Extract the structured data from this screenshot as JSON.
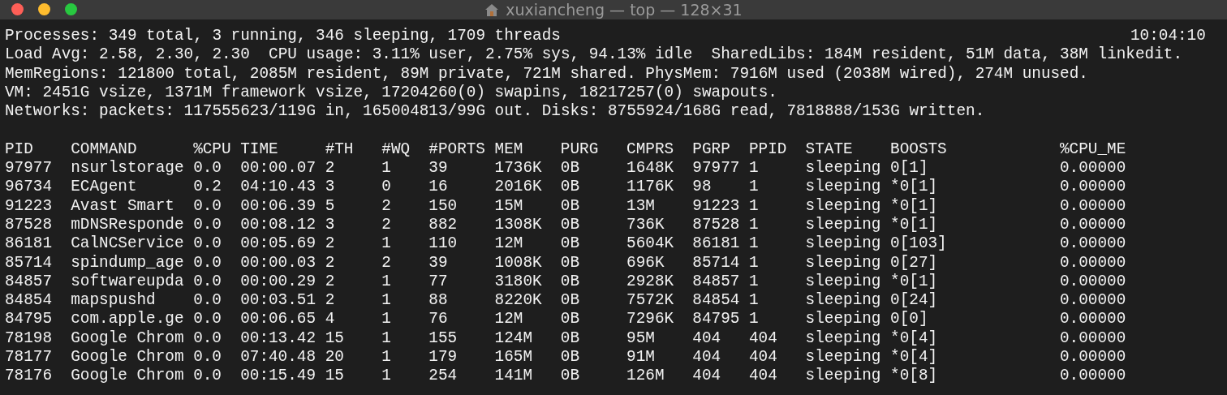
{
  "window": {
    "title": "xuxiancheng — top — 128×31"
  },
  "summary": {
    "time": "10:04:10",
    "lines": [
      "Processes: 349 total, 3 running, 346 sleeping, 1709 threads",
      "Load Avg: 2.58, 2.30, 2.30  CPU usage: 3.11% user, 2.75% sys, 94.13% idle  SharedLibs: 184M resident, 51M data, 38M linkedit.",
      "MemRegions: 121800 total, 2085M resident, 89M private, 721M shared. PhysMem: 7916M used (2038M wired), 274M unused.",
      "VM: 2451G vsize, 1371M framework vsize, 17204260(0) swapins, 18217257(0) swapouts.",
      "Networks: packets: 117555623/119G in, 165004813/99G out. Disks: 8755924/168G read, 7818888/153G written."
    ]
  },
  "table": {
    "columns": [
      "PID",
      "COMMAND",
      "%CPU",
      "TIME",
      "#TH",
      "#WQ",
      "#PORTS",
      "MEM",
      "PURG",
      "CMPRS",
      "PGRP",
      "PPID",
      "STATE",
      "BOOSTS",
      "%CPU_ME"
    ],
    "rows": [
      [
        "97977",
        "nsurlstorage",
        "0.0",
        "00:00.07",
        "2",
        "1",
        "39",
        "1736K",
        "0B",
        "1648K",
        "97977",
        "1",
        "sleeping",
        "0[1]",
        "0.00000"
      ],
      [
        "96734",
        "ECAgent",
        "0.2",
        "04:10.43",
        "3",
        "0",
        "16",
        "2016K",
        "0B",
        "1176K",
        "98",
        "1",
        "sleeping",
        "*0[1]",
        "0.00000"
      ],
      [
        "91223",
        "Avast Smart",
        "0.0",
        "00:06.39",
        "5",
        "2",
        "150",
        "15M",
        "0B",
        "13M",
        "91223",
        "1",
        "sleeping",
        "*0[1]",
        "0.00000"
      ],
      [
        "87528",
        "mDNSResponde",
        "0.0",
        "00:08.12",
        "3",
        "2",
        "882",
        "1308K",
        "0B",
        "736K",
        "87528",
        "1",
        "sleeping",
        "*0[1]",
        "0.00000"
      ],
      [
        "86181",
        "CalNCService",
        "0.0",
        "00:05.69",
        "2",
        "1",
        "110",
        "12M",
        "0B",
        "5604K",
        "86181",
        "1",
        "sleeping",
        "0[103]",
        "0.00000"
      ],
      [
        "85714",
        "spindump_age",
        "0.0",
        "00:00.03",
        "2",
        "2",
        "39",
        "1008K",
        "0B",
        "696K",
        "85714",
        "1",
        "sleeping",
        "0[27]",
        "0.00000"
      ],
      [
        "84857",
        "softwareupda",
        "0.0",
        "00:00.29",
        "2",
        "1",
        "77",
        "3180K",
        "0B",
        "2928K",
        "84857",
        "1",
        "sleeping",
        "*0[1]",
        "0.00000"
      ],
      [
        "84854",
        "mapspushd",
        "0.0",
        "00:03.51",
        "2",
        "1",
        "88",
        "8220K",
        "0B",
        "7572K",
        "84854",
        "1",
        "sleeping",
        "0[24]",
        "0.00000"
      ],
      [
        "84795",
        "com.apple.ge",
        "0.0",
        "00:06.65",
        "4",
        "1",
        "76",
        "12M",
        "0B",
        "7296K",
        "84795",
        "1",
        "sleeping",
        "0[0]",
        "0.00000"
      ],
      [
        "78198",
        "Google Chrom",
        "0.0",
        "00:13.42",
        "15",
        "1",
        "155",
        "124M",
        "0B",
        "95M",
        "404",
        "404",
        "sleeping",
        "*0[4]",
        "0.00000"
      ],
      [
        "78177",
        "Google Chrom",
        "0.0",
        "07:40.48",
        "20",
        "1",
        "179",
        "165M",
        "0B",
        "91M",
        "404",
        "404",
        "sleeping",
        "*0[4]",
        "0.00000"
      ],
      [
        "78176",
        "Google Chrom",
        "0.0",
        "00:15.49",
        "15",
        "1",
        "254",
        "141M",
        "0B",
        "126M",
        "404",
        "404",
        "sleeping",
        "*0[8]",
        "0.00000"
      ]
    ]
  }
}
